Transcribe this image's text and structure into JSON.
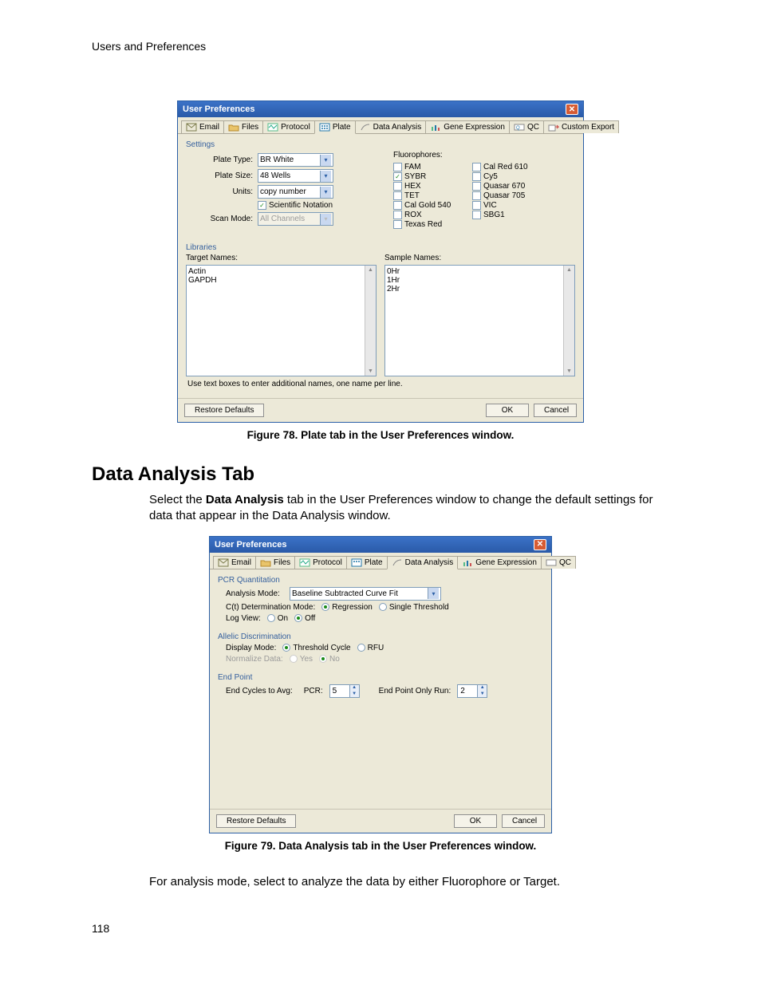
{
  "page": {
    "header": "Users and Preferences",
    "page_number": "118"
  },
  "figure78": {
    "win_title": "User Preferences",
    "tabs": [
      "Email",
      "Files",
      "Protocol",
      "Plate",
      "Data Analysis",
      "Gene Expression",
      "QC",
      "Custom Export"
    ],
    "active_tab_index": 3,
    "settings_label": "Settings",
    "fields": {
      "plate_type_lbl": "Plate Type:",
      "plate_type_val": "BR White",
      "plate_size_lbl": "Plate Size:",
      "plate_size_val": "48 Wells",
      "units_lbl": "Units:",
      "units_val": "copy number",
      "sci_notation_lbl": "Scientific Notation",
      "sci_notation_checked": true,
      "scan_mode_lbl": "Scan Mode:",
      "scan_mode_val": "All Channels"
    },
    "fluor_label": "Fluorophores:",
    "fluorophores": [
      {
        "name": "FAM",
        "checked": false
      },
      {
        "name": "SYBR",
        "checked": true
      },
      {
        "name": "HEX",
        "checked": false
      },
      {
        "name": "TET",
        "checked": false
      },
      {
        "name": "Cal Gold 540",
        "checked": false
      },
      {
        "name": "ROX",
        "checked": false
      },
      {
        "name": "Texas Red",
        "checked": false
      },
      {
        "name": "Cal Red 610",
        "checked": false
      },
      {
        "name": "Cy5",
        "checked": false
      },
      {
        "name": "Quasar 670",
        "checked": false
      },
      {
        "name": "Quasar 705",
        "checked": false
      },
      {
        "name": "VIC",
        "checked": false
      },
      {
        "name": "SBG1",
        "checked": false
      }
    ],
    "libraries_label": "Libraries",
    "target_names_lbl": "Target Names:",
    "target_names": [
      "Actin",
      "GAPDH"
    ],
    "sample_names_lbl": "Sample Names:",
    "sample_names": [
      "0Hr",
      "1Hr",
      "2Hr"
    ],
    "instruction": "Use text boxes to enter additional names, one name per line.",
    "restore_btn": "Restore Defaults",
    "ok_btn": "OK",
    "cancel_btn": "Cancel",
    "caption": "Figure 78. Plate tab in the User Preferences window."
  },
  "section": {
    "title": "Data Analysis Tab",
    "para1_pre": "Select the ",
    "para1_bold": "Data Analysis",
    "para1_post": " tab in the User Preferences window to change the default settings for data that appear in the Data Analysis window."
  },
  "figure79": {
    "win_title": "User Preferences",
    "tabs": [
      "Email",
      "Files",
      "Protocol",
      "Plate",
      "Data Analysis",
      "Gene Expression",
      "QC"
    ],
    "active_tab_index": 4,
    "group_pcr": "PCR Quantitation",
    "analysis_mode_lbl": "Analysis Mode:",
    "analysis_mode_val": "Baseline Subtracted Curve Fit",
    "ctq_lbl": "C(t) Determination Mode:",
    "ctq_opts": [
      "Regression",
      "Single Threshold"
    ],
    "ctq_selected": 0,
    "logview_lbl": "Log View:",
    "logview_opts": [
      "On",
      "Off"
    ],
    "logview_selected": 1,
    "group_allelic": "Allelic Discrimination",
    "display_mode_lbl": "Display Mode:",
    "display_mode_opts": [
      "Threshold Cycle",
      "RFU"
    ],
    "display_mode_selected": 0,
    "normalize_lbl": "Normalize Data:",
    "normalize_opts": [
      "Yes",
      "No"
    ],
    "normalize_selected": 1,
    "group_endpoint": "End Point",
    "end_cycles_lbl": "End Cycles to Avg:",
    "pcr_lbl": "PCR:",
    "pcr_val": "5",
    "eponly_lbl": "End Point Only Run:",
    "eponly_val": "2",
    "restore_btn": "Restore Defaults",
    "ok_btn": "OK",
    "cancel_btn": "Cancel",
    "caption": "Figure 79. Data Analysis tab in the User Preferences window."
  },
  "closing_para": "For analysis mode, select to analyze the data by either Fluorophore or Target."
}
